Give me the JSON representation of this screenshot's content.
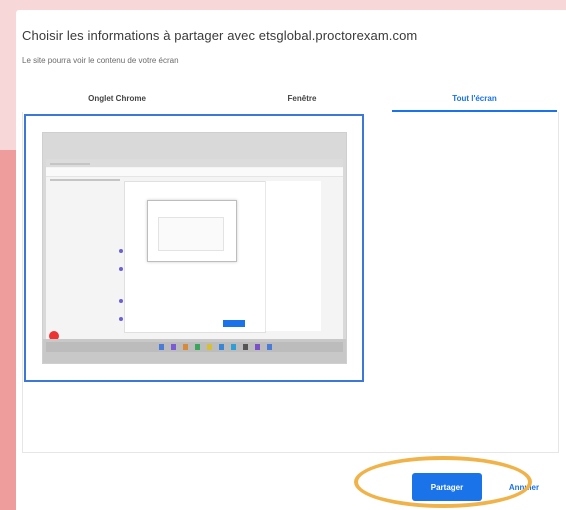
{
  "dialog": {
    "title": "Choisir les informations à partager avec etsglobal.proctorexam.com",
    "subtitle": "Le site pourra voir le contenu de votre écran"
  },
  "tabs": [
    {
      "label": "Onglet Chrome"
    },
    {
      "label": "Fenêtre"
    },
    {
      "label": "Tout l'écran"
    }
  ],
  "selected_tab": "Tout l'écran",
  "footer": {
    "share_label": "Partager",
    "cancel_label": "Annuler"
  },
  "colors": {
    "accent": "#1a73e8",
    "highlight": "#f0b34a",
    "background": "#f6d3d3",
    "left_strip": "#ee9c9c"
  }
}
